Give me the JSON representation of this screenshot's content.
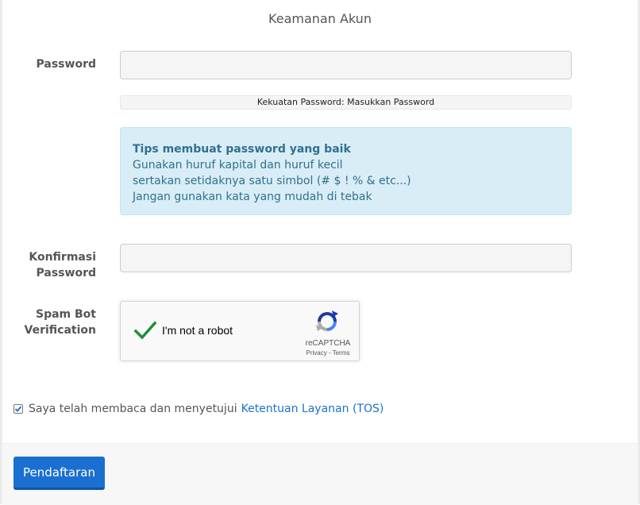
{
  "section_title": "Keamanan Akun",
  "password": {
    "label": "Password",
    "value": "",
    "placeholder": ""
  },
  "strength_text": "Kekuatan Password: Masukkan Password",
  "tips": {
    "title": "Tips membuat password yang baik",
    "lines": [
      "Gunakan huruf kapital dan huruf kecil",
      "sertakan setidaknya satu simbol (# $ ! % & etc...)",
      "Jangan gunakan kata yang mudah di tebak"
    ]
  },
  "confirm": {
    "label_line1": "Konfirmasi",
    "label_line2": "Password",
    "value": "",
    "placeholder": ""
  },
  "spam": {
    "label_line1": "Spam Bot",
    "label_line2": "Verification"
  },
  "recaptcha": {
    "text": "I'm not a robot",
    "brand": "reCAPTCHA",
    "privacy": "Privacy - Terms",
    "checked": true,
    "check_color": "#1e8e3e"
  },
  "tos": {
    "checked": true,
    "text": "Saya telah membaca dan menyetujui",
    "link": "Ketentuan Layanan (TOS)"
  },
  "submit_label": "Pendaftaran",
  "colors": {
    "primary": "#1a6fd0",
    "info_bg": "#d9edf7",
    "info_text": "#31708f",
    "link": "#1a73c9"
  }
}
